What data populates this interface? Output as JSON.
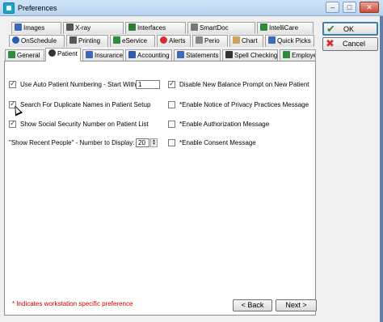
{
  "window": {
    "title": "Preferences",
    "minimize": "–",
    "maximize": "□",
    "close": "✕"
  },
  "tabs_row1": [
    {
      "label": "Images",
      "icon": "image-icon",
      "color": "#3a6ab8"
    },
    {
      "label": "X-ray",
      "icon": "xray-icon",
      "color": "#555555"
    },
    {
      "label": "Interfaces",
      "icon": "interfaces-icon",
      "color": "#2e7d32"
    },
    {
      "label": "SmartDoc",
      "icon": "document-icon",
      "color": "#777777"
    },
    {
      "label": "IntelliCare",
      "icon": "intellicare-icon",
      "color": "#2e8b3a"
    }
  ],
  "tabs_row2": [
    {
      "label": "OnSchedule",
      "icon": "clock-icon",
      "color": "#2a5db0"
    },
    {
      "label": "Printing",
      "icon": "printer-icon",
      "color": "#555555"
    },
    {
      "label": "eService",
      "icon": "eservice-icon",
      "color": "#2e8b3a"
    },
    {
      "label": "Alerts",
      "icon": "alert-icon",
      "color": "#d32f2f"
    },
    {
      "label": "Perio",
      "icon": "perio-icon",
      "color": "#888888"
    },
    {
      "label": "Chart",
      "icon": "chart-icon",
      "color": "#c7a25a"
    },
    {
      "label": "Quick Picks",
      "icon": "grid-icon",
      "color": "#3a6ab8"
    }
  ],
  "tabs_row3": [
    {
      "label": "General",
      "icon": "general-icon",
      "color": "#2e8b3a"
    },
    {
      "label": "Patient",
      "icon": "patient-icon",
      "color": "#333333",
      "active": true
    },
    {
      "label": "Insurance",
      "icon": "insurance-icon",
      "color": "#3a6ab8"
    },
    {
      "label": "Accounting",
      "icon": "accounting-icon",
      "color": "#2a5db0"
    },
    {
      "label": "Statements",
      "icon": "statements-icon",
      "color": "#3a6ab8"
    },
    {
      "label": "Spell Checking",
      "icon": "spellcheck-icon",
      "color": "#333333"
    },
    {
      "label": "Employer",
      "icon": "employer-icon",
      "color": "#2e8b3a"
    }
  ],
  "options_left": [
    {
      "label": "Use Auto Patient Numbering - Start With:",
      "checked": true
    },
    {
      "label": "Search For Duplicate Names in Patient Setup",
      "checked": true
    },
    {
      "label": "Show Social Security Number on Patient List",
      "checked": true
    }
  ],
  "auto_number_start": "1",
  "recent_people": {
    "label": "\"Show Recent People\" - Number to Display:",
    "value": "20"
  },
  "options_right": [
    {
      "label": "Disable New Balance Prompt on New Patient",
      "checked": true
    },
    {
      "label": "*Enable Notice of Privacy Practices Message",
      "checked": false
    },
    {
      "label": "*Enable Authorization Message",
      "checked": false
    },
    {
      "label": "*Enable Consent Message",
      "checked": false
    }
  ],
  "footnote": "* Indicates workstation specific preference",
  "buttons": {
    "ok": "OK",
    "cancel": "Cancel",
    "back": "< Back",
    "next": "Next >"
  },
  "colors": {
    "ok_check": "#2e8b3a",
    "cancel_x": "#d32f2f",
    "footnote": "#cc0000"
  }
}
